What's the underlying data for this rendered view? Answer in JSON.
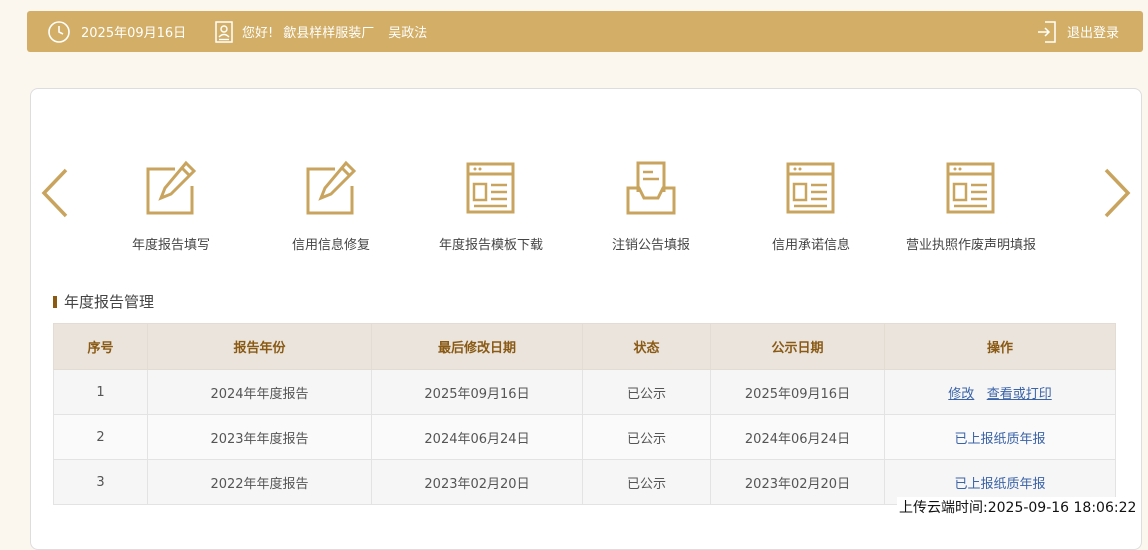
{
  "header": {
    "date": "2025年09月16日",
    "greeting": "您好!",
    "company": "歙县样样服装厂",
    "user": "吴政法",
    "logout_label": "退出登录"
  },
  "carousel": {
    "items": [
      {
        "label": "年度报告填写",
        "icon": "edit-icon"
      },
      {
        "label": "信用信息修复",
        "icon": "edit-icon"
      },
      {
        "label": "年度报告模板下载",
        "icon": "document-window-icon"
      },
      {
        "label": "注销公告填报",
        "icon": "inbox-document-icon"
      },
      {
        "label": "信用承诺信息",
        "icon": "document-window-icon"
      },
      {
        "label": "营业执照作废声明填报",
        "icon": "document-window-icon"
      }
    ]
  },
  "section": {
    "title": "年度报告管理"
  },
  "table": {
    "headers": [
      "序号",
      "报告年份",
      "最后修改日期",
      "状态",
      "公示日期",
      "操作"
    ],
    "rows": [
      {
        "no": "1",
        "year": "2024年年度报告",
        "modified": "2025年09月16日",
        "status": "已公示",
        "publish": "2025年09月16日",
        "op1": "修改",
        "op2": "查看或打印"
      },
      {
        "no": "2",
        "year": "2023年年度报告",
        "modified": "2024年06月24日",
        "status": "已公示",
        "publish": "2024年06月24日",
        "op": "已上报纸质年报"
      },
      {
        "no": "3",
        "year": "2022年年度报告",
        "modified": "2023年02月20日",
        "status": "已公示",
        "publish": "2023年02月20日",
        "op": "已上报纸质年报"
      }
    ]
  },
  "footer": {
    "upload_time": "上传云端时间:2025-09-16 18:06:22"
  },
  "colors": {
    "accent": "#d2ae66",
    "header_text": "#8a5a14",
    "link": "#3b63a8"
  }
}
